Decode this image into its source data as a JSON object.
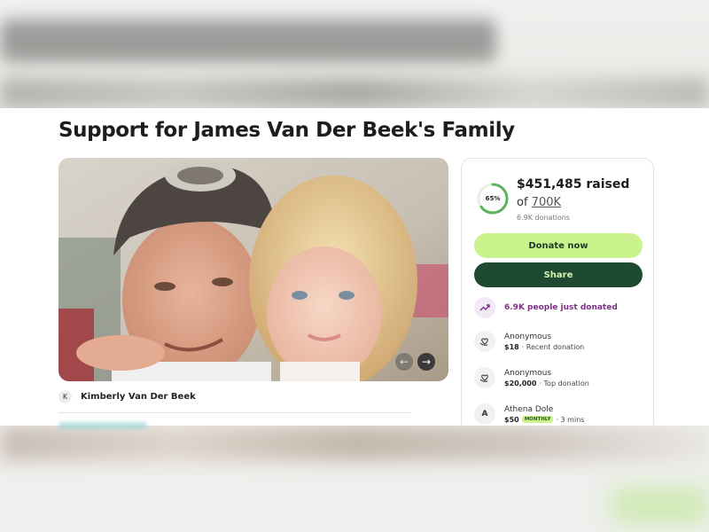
{
  "page": {
    "title": "Support for James Van Der Beek's Family"
  },
  "organizer": {
    "initial": "K",
    "name": "Kimberly Van Der Beek"
  },
  "fundraiser": {
    "progress_percent": 65,
    "progress_label": "65%",
    "raised": "$451,485 raised",
    "goal_prefix": "of",
    "goal_amount": "700K",
    "donations": "6.9K donations",
    "donate_label": "Donate now",
    "share_label": "Share",
    "activity": "6.9K people just donated"
  },
  "donors": [
    {
      "icon": "heart-hand-icon",
      "name": "Anonymous",
      "amount": "$18",
      "note": "· Recent donation"
    },
    {
      "icon": "heart-hand-icon",
      "name": "Anonymous",
      "amount": "$20,000",
      "note": "· Top donation"
    },
    {
      "initial": "A",
      "name": "Athena Dole",
      "amount": "$50",
      "badge": "MONTHLY",
      "note": "· 3 mins"
    }
  ],
  "colors": {
    "accent_green": "#cbf38d",
    "dark_green": "#1f4a32",
    "purple": "#7d2f86"
  }
}
